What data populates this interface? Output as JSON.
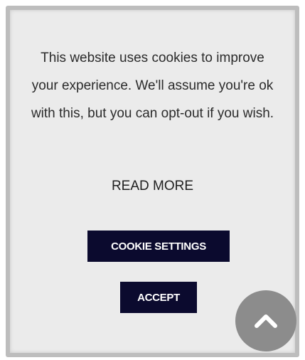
{
  "cookie_banner": {
    "message": "This website uses cookies to improve your experience. We'll assume you're ok with this, but you can opt-out if you wish.",
    "read_more_label": "READ MORE",
    "settings_button_label": "COOKIE SETTINGS",
    "accept_button_label": "ACCEPT"
  },
  "scroll_top": {
    "icon": "chevron-up-icon"
  },
  "colors": {
    "button_bg": "#0b0a2e",
    "panel_bg": "#ebebeb",
    "scroll_button_bg": "#8c8c8c"
  }
}
